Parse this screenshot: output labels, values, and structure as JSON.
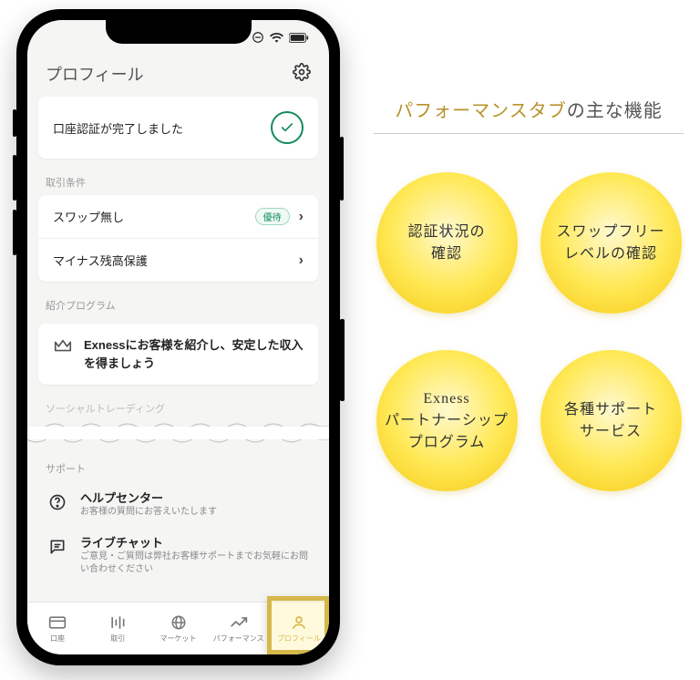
{
  "header": {
    "title": "プロフィール"
  },
  "verification": {
    "message": "口座認証が完了しました"
  },
  "sections": {
    "trading_conditions": {
      "label": "取引条件",
      "items": [
        {
          "label": "スワップ無し",
          "badge": "優待"
        },
        {
          "label": "マイナス残高保護"
        }
      ]
    },
    "referral": {
      "label": "紹介プログラム",
      "promo": "Exnessにお客様を紹介し、安定した収入を得ましょう"
    },
    "social_trading": {
      "label": "ソーシャルトレーディング"
    },
    "support": {
      "label": "サポート",
      "items": [
        {
          "title": "ヘルプセンター",
          "sub": "お客様の質問にお答えいたします"
        },
        {
          "title": "ライブチャット",
          "sub": "ご意見・ご質問は弊社お客様サポートまでお気軽にお問い合わせください"
        }
      ]
    }
  },
  "tabs": [
    {
      "label": "口座"
    },
    {
      "label": "取引"
    },
    {
      "label": "マーケット"
    },
    {
      "label": "パフォーマンス"
    },
    {
      "label": "プロフィール"
    }
  ],
  "features": {
    "title_accent": "パフォーマンスタブ",
    "title_rest": "の主な機能",
    "circles": [
      "認証状況の\n確認",
      "スワップフリー\nレベルの確認",
      "Exness\nパートナーシップ\nプログラム",
      "各種サポート\nサービス"
    ]
  }
}
